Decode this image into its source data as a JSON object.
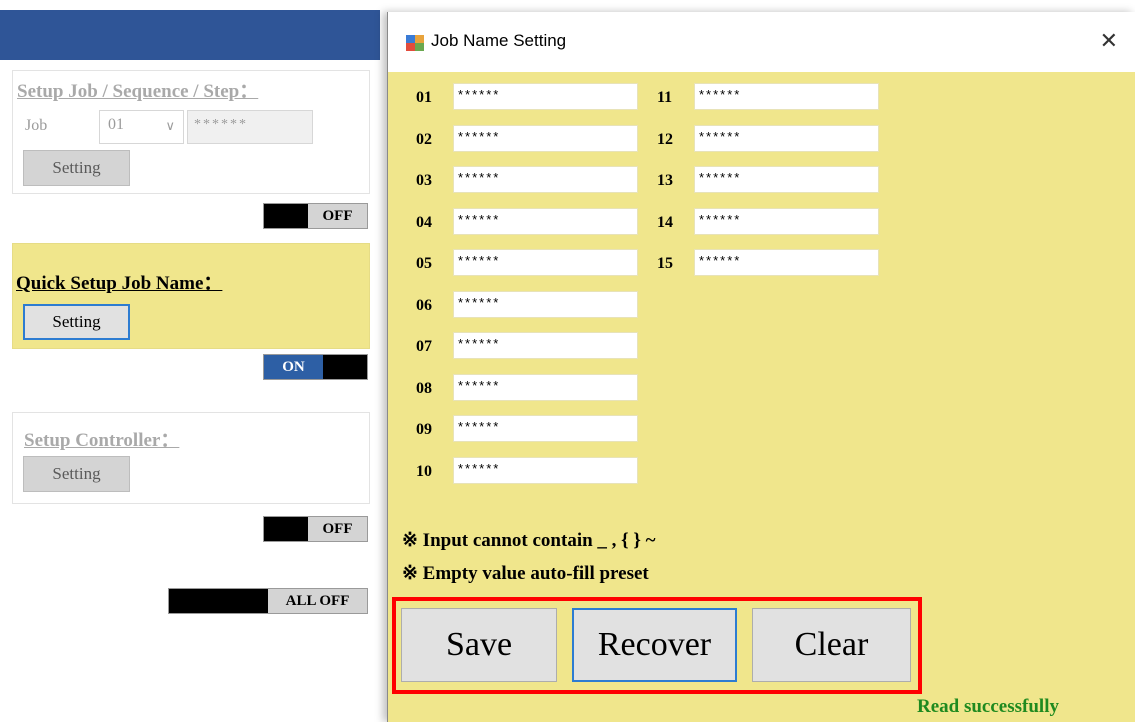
{
  "background": {
    "job_group": {
      "title": "Setup Job / Sequence / Step：",
      "job_label": "Job",
      "job_value": "01",
      "job_name": "******",
      "setting_label": "Setting",
      "toggle_label": "OFF"
    },
    "quick_group": {
      "title": "Quick Setup Job Name：",
      "setting_label": "Setting",
      "toggle_label": "ON"
    },
    "controller_group": {
      "title": "Setup Controller：",
      "setting_label": "Setting",
      "toggle_label": "OFF"
    },
    "all_off_label": "ALL OFF"
  },
  "dialog": {
    "title": "Job Name Setting",
    "close_glyph": "✕",
    "jobs_left": [
      {
        "num": "01",
        "value": "******"
      },
      {
        "num": "02",
        "value": "******"
      },
      {
        "num": "03",
        "value": "******"
      },
      {
        "num": "04",
        "value": "******"
      },
      {
        "num": "05",
        "value": "******"
      },
      {
        "num": "06",
        "value": "******"
      },
      {
        "num": "07",
        "value": "******"
      },
      {
        "num": "08",
        "value": "******"
      },
      {
        "num": "09",
        "value": "******"
      },
      {
        "num": "10",
        "value": "******"
      }
    ],
    "jobs_right": [
      {
        "num": "11",
        "value": "******"
      },
      {
        "num": "12",
        "value": "******"
      },
      {
        "num": "13",
        "value": "******"
      },
      {
        "num": "14",
        "value": "******"
      },
      {
        "num": "15",
        "value": "******"
      }
    ],
    "note1": "※ Input cannot contain _ , { } ~",
    "note2": "※ Empty value auto-fill preset",
    "buttons": {
      "save": "Save",
      "recover": "Recover",
      "clear": "Clear"
    },
    "status": "Read successfully"
  },
  "colors": {
    "dialog_bg": "#f0e68c",
    "highlight": "#ff0000",
    "status": "#1f8a1f",
    "on_toggle": "#2d5fa5"
  }
}
